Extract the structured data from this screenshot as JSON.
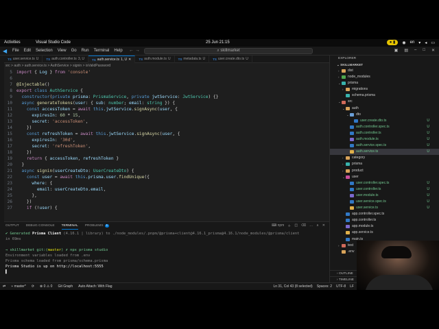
{
  "system_bar": {
    "activities": "Activities",
    "app": "Visual Studio Code",
    "clock": "25 Jun  21:15",
    "lang": "en"
  },
  "titlebar": {
    "menus": [
      "File",
      "Edit",
      "Selection",
      "View",
      "Go",
      "Run",
      "Terminal",
      "Help"
    ],
    "search": "skillmarket"
  },
  "tabs": [
    {
      "label": "user.service.ts",
      "status": "U",
      "active": false
    },
    {
      "label": "auth.controller.ts",
      "status": "3, U",
      "active": false
    },
    {
      "label": "auth.service.ts",
      "status": "1, U",
      "active": true
    },
    {
      "label": "auth.module.ts",
      "status": "U",
      "active": false
    },
    {
      "label": "metadata.ts",
      "status": "U",
      "active": false
    },
    {
      "label": "user.create.dto.ts",
      "status": "U",
      "active": false
    }
  ],
  "breadcrumb": "src > auth > auth.service.ts > AuthService > signin > isValidPassword",
  "editor": {
    "line_numbers": [
      "5",
      "6",
      "7",
      "8",
      "9",
      "10",
      "11",
      "12",
      "13",
      "14",
      "15",
      "16",
      "17",
      "18",
      "19",
      "20",
      "21",
      "22",
      "23",
      "24",
      "25",
      "26",
      "27",
      "28",
      "29",
      "30"
    ]
  },
  "panel": {
    "tabs": [
      "OUTPUT",
      "DEBUG CONSOLE",
      "TERMINAL",
      "PROBLEMS"
    ],
    "problems_count": "1",
    "shell": "npm",
    "terminal": {
      "l1": "✔ Generated ",
      "l1b": "Prisma Client",
      "l1c": " (4.16.1 | library) to ./node_modules/.pnpm/@prisma+client@4.16.1_prisma@4.16.1/node_modules/@prisma/client",
      "l2": "in 69ms",
      "l3": "→ skillmarket git:(",
      "l3b": "master",
      "l3c": ") ✗ npx prisma studio",
      "l4": "Environment variables loaded from .env",
      "l5": "Prisma schema loaded from prisma/schema.prisma",
      "l6": "Prisma Studio is up on http://localhost:5555"
    }
  },
  "explorer": {
    "title": "EXPLORER",
    "root": "SKILLMARKET",
    "items": [
      {
        "name": "dist",
        "depth": 1,
        "folder": true,
        "icon": "fo"
      },
      {
        "name": "node_modules",
        "depth": 1,
        "folder": true,
        "icon": "fs"
      },
      {
        "name": "prisma",
        "depth": 1,
        "folder": true,
        "open": true,
        "icon": "fp"
      },
      {
        "name": "migrations",
        "depth": 2,
        "folder": true,
        "icon": "fo"
      },
      {
        "name": "schema.prisma",
        "depth": 2,
        "icon": "fp"
      },
      {
        "name": "src",
        "depth": 1,
        "folder": true,
        "open": true,
        "icon": "fg"
      },
      {
        "name": "auth",
        "depth": 2,
        "folder": true,
        "open": true,
        "icon": "fo"
      },
      {
        "name": "dto",
        "depth": 3,
        "folder": true,
        "open": true,
        "icon": "fb"
      },
      {
        "name": "user.create.dto.ts",
        "depth": 4,
        "icon": "fts",
        "status": "U"
      },
      {
        "name": "auth.controller.spec.ts",
        "depth": 3,
        "icon": "fts",
        "status": "U"
      },
      {
        "name": "auth.controller.ts",
        "depth": 3,
        "icon": "fts",
        "status": "U"
      },
      {
        "name": "auth.module.ts",
        "depth": 3,
        "icon": "fd",
        "status": "U"
      },
      {
        "name": "auth.service.spec.ts",
        "depth": 3,
        "icon": "fts",
        "status": "U"
      },
      {
        "name": "auth.service.ts",
        "depth": 3,
        "icon": "fu",
        "status": "U",
        "selected": true
      },
      {
        "name": "category",
        "depth": 2,
        "folder": true,
        "icon": "fo"
      },
      {
        "name": "prisma",
        "depth": 2,
        "folder": true,
        "icon": "fp"
      },
      {
        "name": "product",
        "depth": 2,
        "folder": true,
        "icon": "fo"
      },
      {
        "name": "user",
        "depth": 2,
        "folder": true,
        "open": true,
        "icon": "fy"
      },
      {
        "name": "user.controller.spec.ts",
        "depth": 3,
        "icon": "fts",
        "status": "U"
      },
      {
        "name": "user.controller.ts",
        "depth": 3,
        "icon": "fts",
        "status": "U"
      },
      {
        "name": "user.module.ts",
        "depth": 3,
        "icon": "fd",
        "status": "U"
      },
      {
        "name": "user.service.spec.ts",
        "depth": 3,
        "icon": "fts",
        "status": "U"
      },
      {
        "name": "user.service.ts",
        "depth": 3,
        "icon": "fu",
        "status": "U"
      },
      {
        "name": "app.controller.spec.ts",
        "depth": 2,
        "icon": "fts"
      },
      {
        "name": "app.controller.ts",
        "depth": 2,
        "icon": "fts"
      },
      {
        "name": "app.module.ts",
        "depth": 2,
        "icon": "fd"
      },
      {
        "name": "app.service.ts",
        "depth": 2,
        "icon": "fu"
      },
      {
        "name": "main.ts",
        "depth": 2,
        "icon": "fts"
      },
      {
        "name": "test",
        "depth": 1,
        "folder": true,
        "icon": "fg"
      },
      {
        "name": ".env",
        "depth": 1,
        "icon": "fo"
      }
    ],
    "outline": "OUTLINE",
    "timeline": "TIMELINE"
  },
  "statusbar": {
    "branch": "master*",
    "git_graph": "Git Graph",
    "auto_attach": "Auto Attach: With Flag",
    "position": "Ln 31, Col 43 (8 selected)",
    "spaces": "Spaces: 2",
    "encoding": "UTF-8",
    "eol": "LF",
    "lang": "TypeScript"
  },
  "colors": {
    "accent": "#0078d4",
    "untracked": "#73c991",
    "highlight": "#e5c300"
  }
}
